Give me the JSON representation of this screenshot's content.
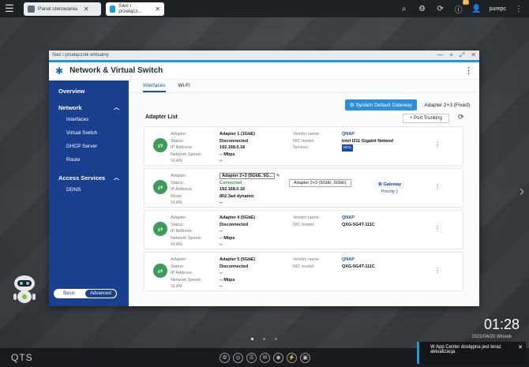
{
  "taskbar": {
    "tabs": [
      {
        "label": "Panel sterowania"
      },
      {
        "label": "Sieć i przełącz..."
      }
    ],
    "user": "purepc",
    "notifications_count": "10"
  },
  "window": {
    "title": "Sieć i przełącznik wirtualny",
    "app_name": "Network & Virtual Switch"
  },
  "sidebar": {
    "overview": "Overview",
    "network": "Network",
    "network_items": [
      "Interfaces",
      "Virtual Switch",
      "DHCP Server",
      "Route"
    ],
    "access": "Access Services",
    "access_items": [
      "DDNS"
    ],
    "mode_basic": "Basic",
    "mode_advanced": "Advanced"
  },
  "tabs": {
    "interfaces": "Interfaces",
    "wifi": "Wi-Fi"
  },
  "gateway_button": "System Default Gateway",
  "gateway_value": "Adapter 2+3 (Fixed)",
  "adapter_list": "Adapter List",
  "port_trunking": "Port Trunking",
  "labels": {
    "adapter": "Adapter:",
    "status": "Status:",
    "ip": "IP Address:",
    "speed": "Network Speed:",
    "mode": "Mode:",
    "vlan": "VLAN:",
    "vendor": "Vendor name:",
    "nic": "NIC model:",
    "service": "Service:"
  },
  "adapters": [
    {
      "name": "Adapter 1 (1GbE)",
      "status": "Disconnected",
      "ip": "192.168.0.18",
      "speed": "-- Mbps",
      "vlan": "--",
      "vendor": "QNAP",
      "nic": "Intel I211 Gigabit Networl",
      "service": "WOL"
    },
    {
      "name": "Adapter 2+3 (5GbE, 5G...",
      "status": "Connected",
      "ip": "192.168.0.16",
      "mode": "802.3ad dynamic",
      "vlan": "--",
      "tooltip": "Adapter 2+3 (5GbE, 5GbE)",
      "gateway": "Gateway",
      "priority": "Priority 1"
    },
    {
      "name": "Adapter 4 (5GbE)",
      "status": "Disconnected",
      "ip": "--",
      "speed": "-- Mbps",
      "vlan": "--",
      "vendor": "QNAP",
      "nic": "QXG-5G4T-111C"
    },
    {
      "name": "Adapter 5 (5GbE)",
      "status": "Disconnected",
      "ip": "--",
      "speed": "-- Mbps",
      "vlan": "--",
      "vendor": "QNAP",
      "nic": "QXG-5G4T-111C"
    }
  ],
  "desktop": {
    "time": "01:28",
    "date": "2021/04/20 Wtorek",
    "brand": "QTS",
    "notification": "W App Center dostępna jest teraz aktualizacja"
  }
}
